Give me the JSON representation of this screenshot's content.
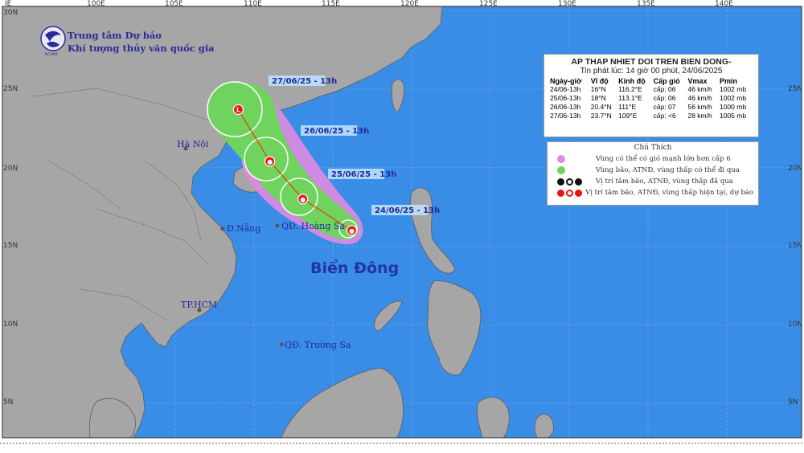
{
  "org": {
    "line1": "Trung tâm Dự báo",
    "line2": "Khí tượng thủy văn quốc gia",
    "logo_text": "NCHMF"
  },
  "axes": {
    "x_ticks": [
      "IE",
      "100E",
      "105E",
      "110E",
      "115E",
      "120E",
      "125E",
      "130E",
      "135E",
      "140E"
    ],
    "y_ticks": [
      "30N",
      "25N",
      "20N",
      "15N",
      "10N",
      "5N"
    ]
  },
  "places": {
    "hanoi": "Hà Nội",
    "danang": "Đ.Nẵng",
    "hoangsa": "QĐ. Hoàng Sa",
    "hcm": "TP.HCM",
    "truongsa": "QĐ. Trường Sa",
    "sea": "Biển Đông"
  },
  "track_labels": [
    "24/06/25 - 13h",
    "25/06/25 - 13h",
    "26/06/25 - 13h",
    "27/06/25 - 13h"
  ],
  "track_points": [
    {
      "lat": 16.0,
      "lon": 116.2
    },
    {
      "lat": 18.0,
      "lon": 113.1
    },
    {
      "lat": 20.4,
      "lon": 111.0
    },
    {
      "lat": 23.7,
      "lon": 109.0
    }
  ],
  "info": {
    "title": "AP THAP NHIET DOI TREN BIEN DONG-",
    "issued": "Tin phát lúc: 14 giờ 00 phút, 24/06/2025",
    "headers": [
      "Ngày-giờ",
      "Vĩ độ",
      "Kinh độ",
      "Cấp gió",
      "Vmax",
      "Pmin"
    ],
    "rows": [
      [
        "24/06-13h",
        "16°N",
        "116.2°E",
        "cấp: 06",
        "46 km/h",
        "1002 mb"
      ],
      [
        "25/06-13h",
        "18°N",
        "113.1°E",
        "cấp: 06",
        "46 km/h",
        "1002 mb"
      ],
      [
        "26/06-13h",
        "20.4°N",
        "111°E",
        "cấp: 07",
        "56 km/h",
        "1000 mb"
      ],
      [
        "27/06-13h",
        "23.7°N",
        "109°E",
        "cấp: <6",
        "28 km/h",
        "1005 mb"
      ]
    ]
  },
  "legend": {
    "title": "Chú Thích",
    "items": [
      "Vùng có thể có gió mạnh lớn hơn cấp 6",
      "Vùng bão, ATNĐ, vùng thấp có thể đi qua",
      "Vị trí tâm bão, ATNĐ, vùng thấp đã qua",
      "Vị trí tâm bão, ATNĐ, vùng thấp hiện tại, dự báo"
    ]
  },
  "colors": {
    "sea": "#3a8de6",
    "land": "#a6a6a6",
    "grid": "#6fb0ee",
    "cone_green": "#6fd35e",
    "wind_pink": "#e08ae0",
    "track": "#e04000",
    "marker_red": "#ee1111"
  }
}
